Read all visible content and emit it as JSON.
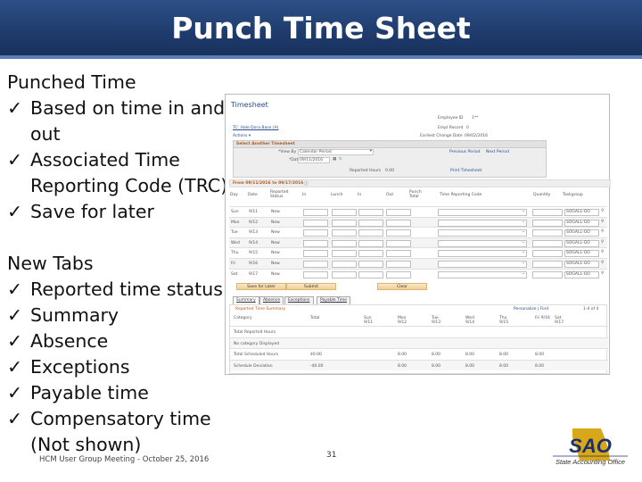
{
  "slide": {
    "title": "Punch Time Sheet",
    "footer": "HCM User Group Meeting - October 25, 2016",
    "page_number": "31",
    "logo_text": "SAO",
    "logo_subtext": "State Accounting Office"
  },
  "bullets": {
    "heading1": "Punched Time",
    "items1": [
      "Based on time in and out",
      "Associated Time Reporting Code (TRC)",
      "Save for later"
    ],
    "heading2": "New Tabs",
    "items2": [
      "Reported time status",
      "Summary",
      "Absence",
      "Exceptions",
      "Payable time",
      "Compensatory time (Not shown)"
    ],
    "check": "ü"
  },
  "timesheet": {
    "title": "Timesheet",
    "employee_link": "TC: Hale Dora Base (A)",
    "actions": "Actions ▾",
    "employee_id_label": "Employee ID",
    "employee_id": "1**",
    "empl_record_label": "Empl Record",
    "empl_record": "0",
    "earliest_change_label": "Earliest Change Date",
    "earliest_change": "09/02/2016",
    "select_header": "Select Another Timesheet",
    "view_by_label": "*View By",
    "view_by": "Calendar Period",
    "date_label": "*Date",
    "date": "09/11/2016",
    "previous_period": "Previous Period",
    "next_period": "Next Period",
    "reported_hours_label": "Reported Hours",
    "reported_hours": "0.00",
    "print_timesheet": "Print Timesheet",
    "period_header": "From 09/11/2016 to 09/17/2016",
    "columns": [
      "Day",
      "Date",
      "Reported Status",
      "In",
      "Lunch",
      "In",
      "Out",
      "Punch Total",
      "Time Reporting Code",
      "Quantity",
      "Taskgroup"
    ],
    "rows": [
      {
        "day": "Sun",
        "date": "9/11",
        "status": "New",
        "taskgroup": "SOGALL-GO"
      },
      {
        "day": "Mon",
        "date": "9/12",
        "status": "New",
        "taskgroup": "SOGALL-GO"
      },
      {
        "day": "Tue",
        "date": "9/13",
        "status": "New",
        "taskgroup": "SOGALL-GO"
      },
      {
        "day": "Wed",
        "date": "9/14",
        "status": "New",
        "taskgroup": "SOGALL-GO"
      },
      {
        "day": "Thu",
        "date": "9/15",
        "status": "New",
        "taskgroup": "SOGALL-GO"
      },
      {
        "day": "Fri",
        "date": "9/16",
        "status": "New",
        "taskgroup": "SOGALL-GO"
      },
      {
        "day": "Sat",
        "date": "9/17",
        "status": "New",
        "taskgroup": "SOGALL-GO"
      }
    ],
    "buttons": {
      "save": "Save for Later",
      "submit": "Submit",
      "clear": "Clear"
    },
    "tabs": [
      "Summary",
      "Absence",
      "Exceptions",
      "Payable Time"
    ],
    "summary": {
      "title": "Reported Time Summary",
      "personalize": "Personalize | Find",
      "count": "1-4 of 4",
      "headers": [
        "Category",
        "Total",
        "Sun 9/11",
        "Mon 9/12",
        "Tue 9/13",
        "Wed 9/14",
        "Thu 9/15",
        "Fri 9/16",
        "Sat 9/17"
      ],
      "rows": [
        {
          "category": "Total Reported Hours",
          "values": [
            "",
            "",
            "",
            "",
            "",
            "",
            "",
            ""
          ]
        },
        {
          "category": "No category Displayed",
          "values": [
            "",
            "",
            "",
            "",
            "",
            "",
            "",
            ""
          ]
        },
        {
          "category": "Total Scheduled Hours",
          "values": [
            "40.00",
            "",
            "8.00",
            "8.00",
            "8.00",
            "8.00",
            "8.00",
            ""
          ]
        },
        {
          "category": "Schedule Deviation",
          "values": [
            "-40.00",
            "",
            "8.00",
            "8.00",
            "8.00",
            "8.00",
            "8.00",
            ""
          ]
        }
      ]
    }
  },
  "colors": {
    "header_bg": "#1e3a6b",
    "title_text": "#ffffff",
    "accent_orange": "#b25a1a",
    "logo_navy": "#1b2f6b",
    "logo_gold": "#d9a81a"
  }
}
